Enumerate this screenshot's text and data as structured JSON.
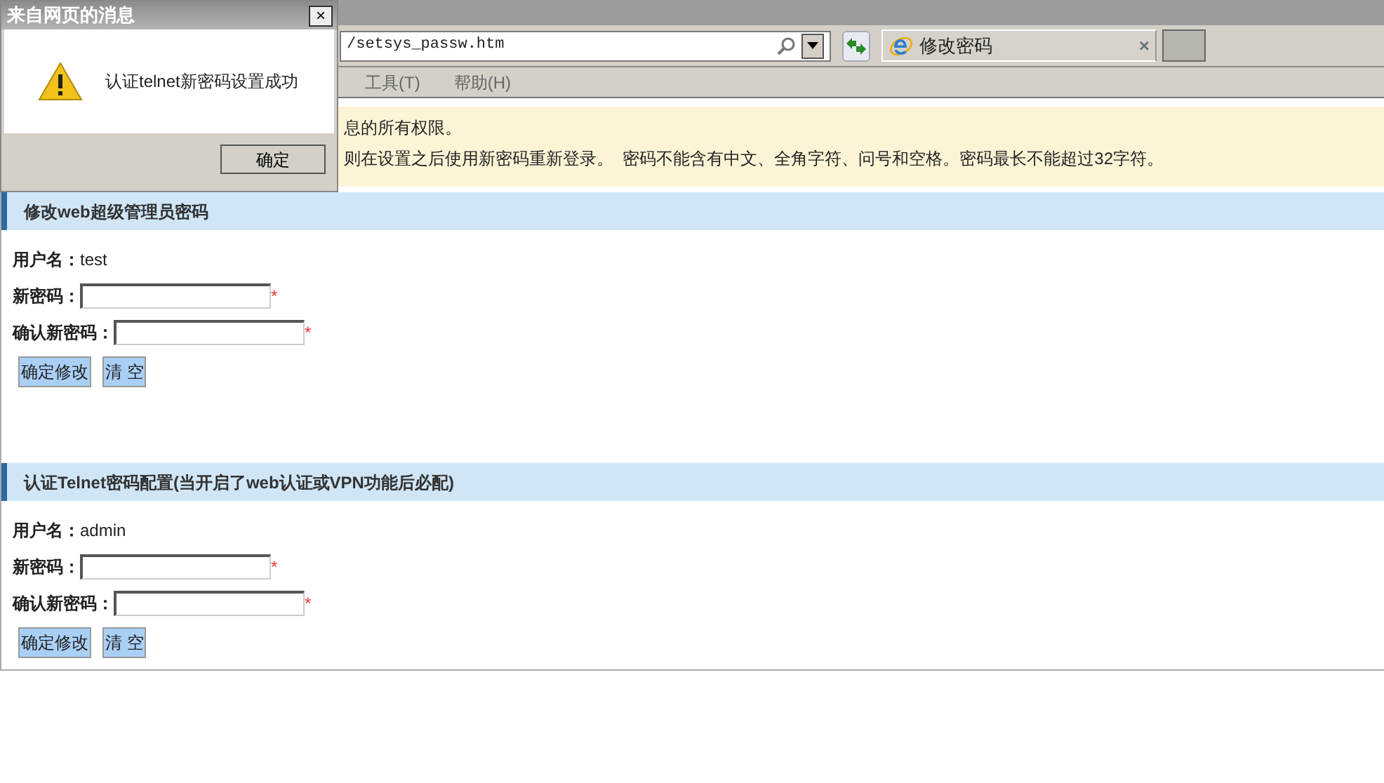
{
  "dialog": {
    "title": "来自网页的消息",
    "close": "×",
    "message": "认证telnet新密码设置成功",
    "button": "确定"
  },
  "browser": {
    "address": "/setsys_passw.htm",
    "tab_title": "修改密码",
    "tab_close": "×",
    "menu": [
      "工具(T)",
      "帮助(H)"
    ]
  },
  "notice": [
    "息的所有权限。",
    "则在设置之后使用新密码重新登录。  密码不能含有中文、全角字符、问号和空格。密码最长不能超过32字符。"
  ],
  "sections": [
    {
      "title": "修改web超级管理员密码",
      "username_label": "用户名：",
      "username": "test",
      "fields": [
        {
          "label": "新密码：",
          "required_mark": "*"
        },
        {
          "label": "确认新密码：",
          "required_mark": "*"
        }
      ],
      "buttons": [
        "确定修改",
        "清 空"
      ]
    },
    {
      "title": "认证Telnet密码配置(当开启了web认证或VPN功能后必配)",
      "username_label": "用户名：",
      "username": "admin",
      "fields": [
        {
          "label": "新密码：",
          "required_mark": "*"
        },
        {
          "label": "确认新密码：",
          "required_mark": "*"
        }
      ],
      "buttons": [
        "确定修改",
        "清 空"
      ]
    }
  ]
}
